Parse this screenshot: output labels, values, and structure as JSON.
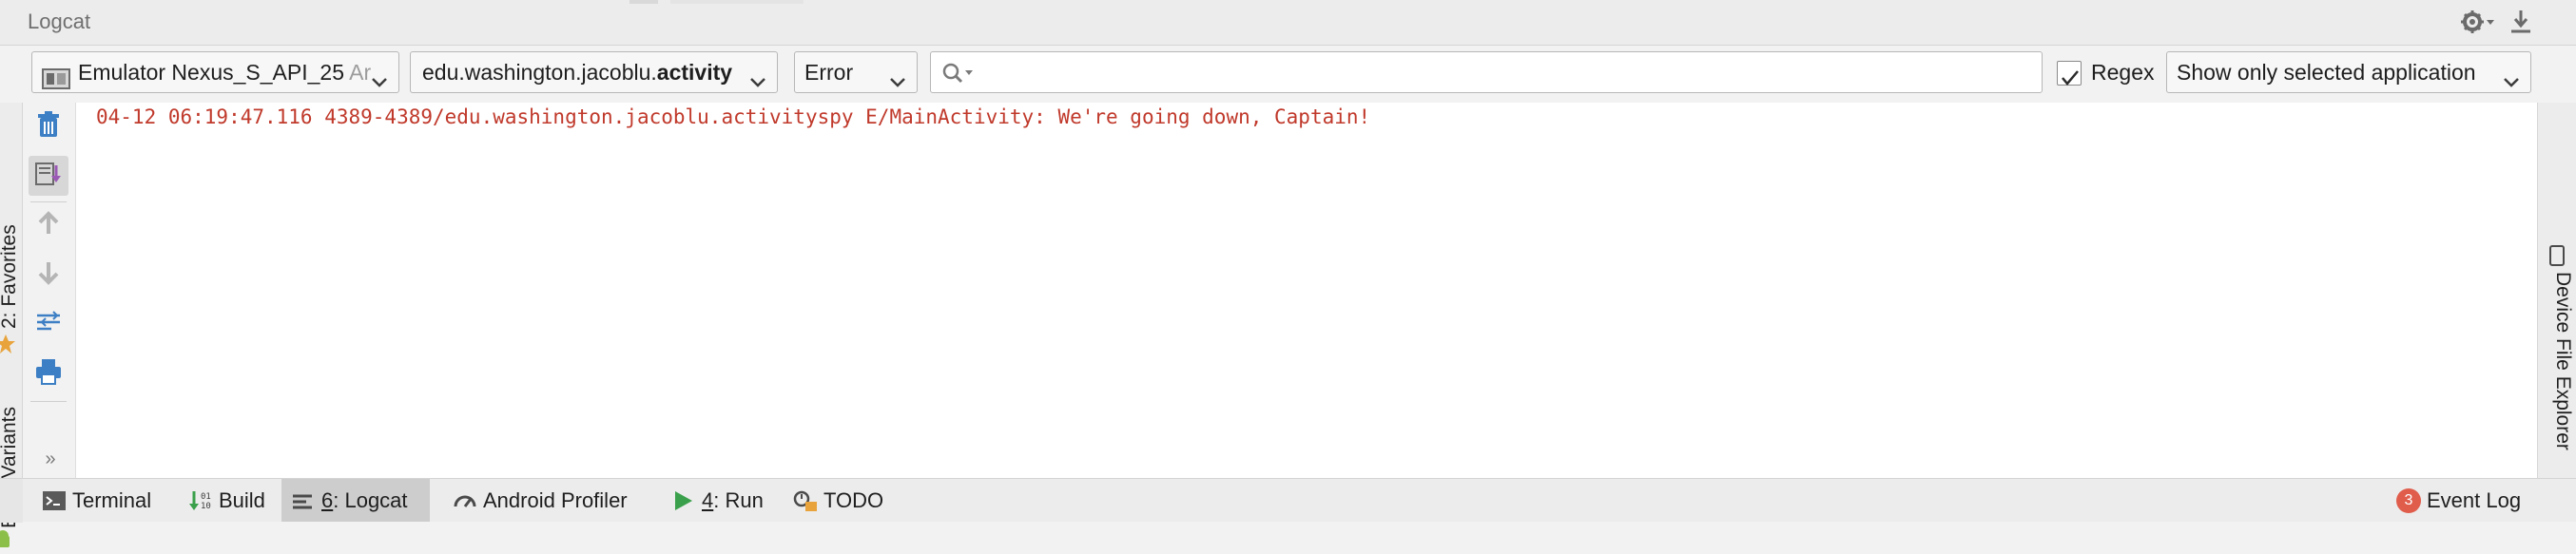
{
  "window": {
    "title": "Logcat"
  },
  "toolbar": {
    "device": {
      "name": "Emulator Nexus_S_API_25",
      "suffix": "Ar"
    },
    "process": {
      "prefix": "edu.washington.jacoblu.",
      "bold": "activity"
    },
    "log_level": "Error",
    "search": {
      "value": "",
      "placeholder": ""
    },
    "regex": {
      "label": "Regex",
      "checked": true
    },
    "filter": "Show only selected application"
  },
  "left_stripe": {
    "favorites": "2: Favorites",
    "build_variants": "Build Variants"
  },
  "right_stripe": {
    "device_file_explorer": "Device File Explorer"
  },
  "actions": {
    "more": "»"
  },
  "log": {
    "lines": [
      "04-12 06:19:47.116 4389-4389/edu.washington.jacoblu.activityspy E/MainActivity: We're going down, Captain!"
    ],
    "error_color": "#c0392b"
  },
  "bottom_tabs": {
    "terminal": "Terminal",
    "build": "Build",
    "logcat_num": "6",
    "logcat": ": Logcat",
    "android_profiler": "Android Profiler",
    "run_num": "4",
    "run": ": Run",
    "todo": "TODO",
    "event_log_count": "3",
    "event_log": "Event Log"
  },
  "icons": {
    "gear": "gear-icon",
    "pin": "hide-icon",
    "device": "device-icon",
    "search": "search-icon",
    "trash": "clear-logcat-icon",
    "scroll_end": "scroll-to-end-icon",
    "up": "up-arrow-icon",
    "down": "down-arrow-icon",
    "soft_wrap": "soft-wraps-icon",
    "print": "print-icon",
    "run": "run-triangle-icon",
    "profiler": "profiler-gauge-icon",
    "build": "build-icon",
    "todo": "todo-icon",
    "terminal": "terminal-icon"
  },
  "colors": {
    "accent_run": "#3aa04b",
    "badge": "#e05d4c",
    "icon_blue": "#3d7fc4"
  }
}
